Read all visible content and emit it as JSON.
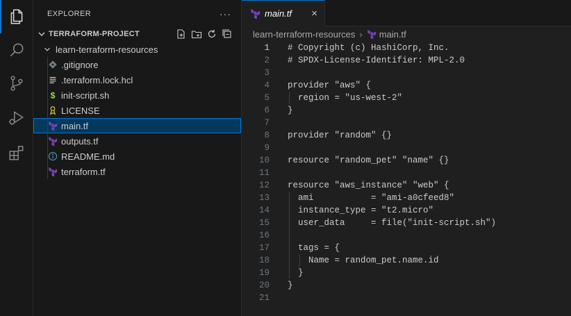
{
  "activity_bar": {
    "items": [
      {
        "name": "explorer",
        "icon": "files-icon",
        "active": true
      },
      {
        "name": "search",
        "icon": "search-icon"
      },
      {
        "name": "source-control",
        "icon": "source-control-icon"
      },
      {
        "name": "run-debug",
        "icon": "run-debug-icon"
      },
      {
        "name": "extensions",
        "icon": "extensions-icon"
      }
    ]
  },
  "sidebar": {
    "title": "EXPLORER",
    "more": "···",
    "section_title": "TERRAFORM-PROJECT",
    "folder": "learn-terraform-resources",
    "files": [
      {
        "label": ".gitignore",
        "icon": "gitignore-icon",
        "color": "#6d8086"
      },
      {
        "label": ".terraform.lock.hcl",
        "icon": "file-lines-icon",
        "color": "#c5c5c5"
      },
      {
        "label": "init-script.sh",
        "icon": "shell-dollar-icon",
        "color": "#89e051"
      },
      {
        "label": "LICENSE",
        "icon": "license-icon",
        "color": "#cbcb41"
      },
      {
        "label": "main.tf",
        "icon": "terraform-icon",
        "color": "#7b42bc",
        "selected": true
      },
      {
        "label": "outputs.tf",
        "icon": "terraform-icon",
        "color": "#7b42bc"
      },
      {
        "label": "README.md",
        "icon": "info-icon",
        "color": "#519aba"
      },
      {
        "label": "terraform.tf",
        "icon": "terraform-icon",
        "color": "#7b42bc"
      }
    ]
  },
  "editor": {
    "tab_label": "main.tf",
    "tab_close": "×",
    "breadcrumb": {
      "folder": "learn-terraform-resources",
      "separator": "›",
      "file": "main.tf"
    },
    "current_line": 1,
    "lines": [
      {
        "n": "1",
        "text": "# Copyright (c) HashiCorp, Inc."
      },
      {
        "n": "2",
        "text": "# SPDX-License-Identifier: MPL-2.0"
      },
      {
        "n": "3",
        "text": ""
      },
      {
        "n": "4",
        "text": "provider \"aws\" {"
      },
      {
        "n": "5",
        "text": "  region = \"us-west-2\""
      },
      {
        "n": "6",
        "text": "}"
      },
      {
        "n": "7",
        "text": ""
      },
      {
        "n": "8",
        "text": "provider \"random\" {}"
      },
      {
        "n": "9",
        "text": ""
      },
      {
        "n": "10",
        "text": "resource \"random_pet\" \"name\" {}"
      },
      {
        "n": "11",
        "text": ""
      },
      {
        "n": "12",
        "text": "resource \"aws_instance\" \"web\" {"
      },
      {
        "n": "13",
        "text": "  ami           = \"ami-a0cfeed8\""
      },
      {
        "n": "14",
        "text": "  instance_type = \"t2.micro\""
      },
      {
        "n": "15",
        "text": "  user_data     = file(\"init-script.sh\")"
      },
      {
        "n": "16",
        "text": ""
      },
      {
        "n": "17",
        "text": "  tags = {"
      },
      {
        "n": "18",
        "text": "    Name = random_pet.name.id"
      },
      {
        "n": "19",
        "text": "  }"
      },
      {
        "n": "20",
        "text": "}"
      },
      {
        "n": "21",
        "text": ""
      }
    ]
  },
  "colors": {
    "accent": "#0078d4",
    "selection": "#04395e",
    "terraform": "#7b42bc"
  }
}
